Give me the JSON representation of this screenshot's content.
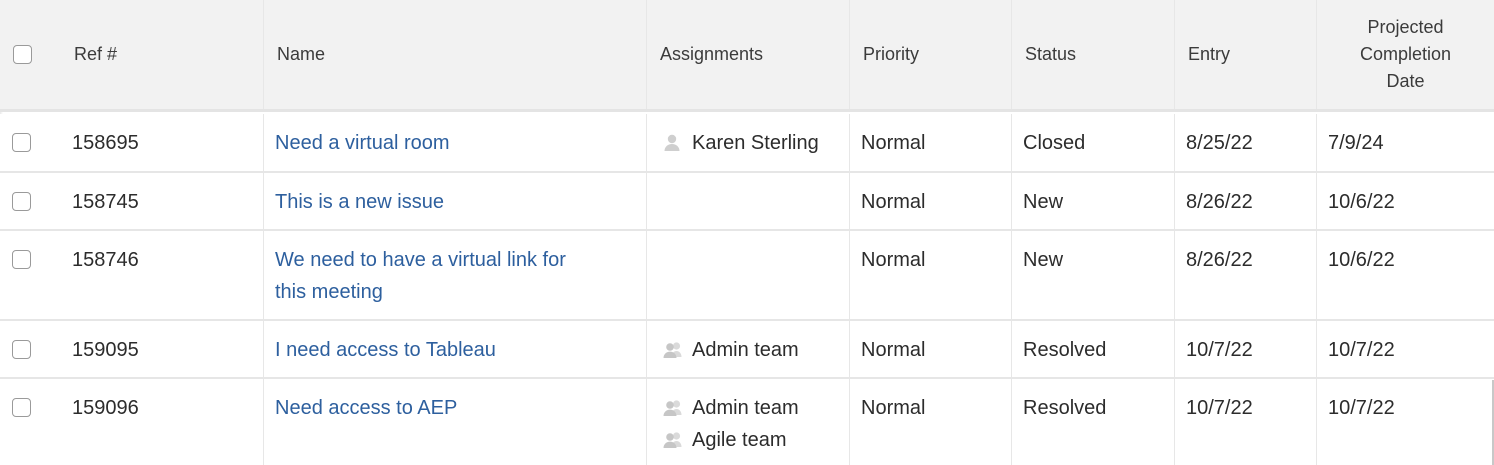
{
  "columns": {
    "ref": "Ref #",
    "name": "Name",
    "assignments": "Assignments",
    "priority": "Priority",
    "status": "Status",
    "entry": "Entry",
    "projected_line1": "Projected",
    "projected_line2": "Completion",
    "projected_line3": "Date"
  },
  "rows": [
    {
      "ref": "158695",
      "name_line1": "Need a virtual room",
      "name_line2": "",
      "assignee1": "Karen Sterling",
      "assignee1_icon": "user-icon",
      "assignee2": "",
      "priority": "Normal",
      "status": "Closed",
      "entry": "8/25/22",
      "projected": "7/9/24"
    },
    {
      "ref": "158745",
      "name_line1": "This is a new issue",
      "name_line2": "",
      "assignee1": "",
      "assignee2": "",
      "priority": "Normal",
      "status": "New",
      "entry": "8/26/22",
      "projected": "10/6/22"
    },
    {
      "ref": "158746",
      "name_line1": "We need to have a virtual link for",
      "name_line2": "this meeting",
      "assignee1": "",
      "assignee2": "",
      "priority": "Normal",
      "status": "New",
      "entry": "8/26/22",
      "projected": "10/6/22"
    },
    {
      "ref": "159095",
      "name_line1": "I need access to Tableau",
      "name_line2": "",
      "assignee1": "Admin team",
      "assignee1_icon": "team-icon",
      "assignee2": "",
      "priority": "Normal",
      "status": "Resolved",
      "entry": "10/7/22",
      "projected": "10/7/22"
    },
    {
      "ref": "159096",
      "name_line1": "Need access to AEP",
      "name_line2": "",
      "assignee1": "Admin team",
      "assignee1_icon": "team-icon",
      "assignee2": "Agile team",
      "assignee2_icon": "team-icon",
      "priority": "Normal",
      "status": "Resolved",
      "entry": "10/7/22",
      "projected": "10/7/22"
    }
  ],
  "colors": {
    "header_bg": "#f2f2f2",
    "link": "#2d5f9e",
    "text": "#2c2c2c",
    "divider": "#e6e6e6",
    "icon": "#c9c9c9"
  }
}
